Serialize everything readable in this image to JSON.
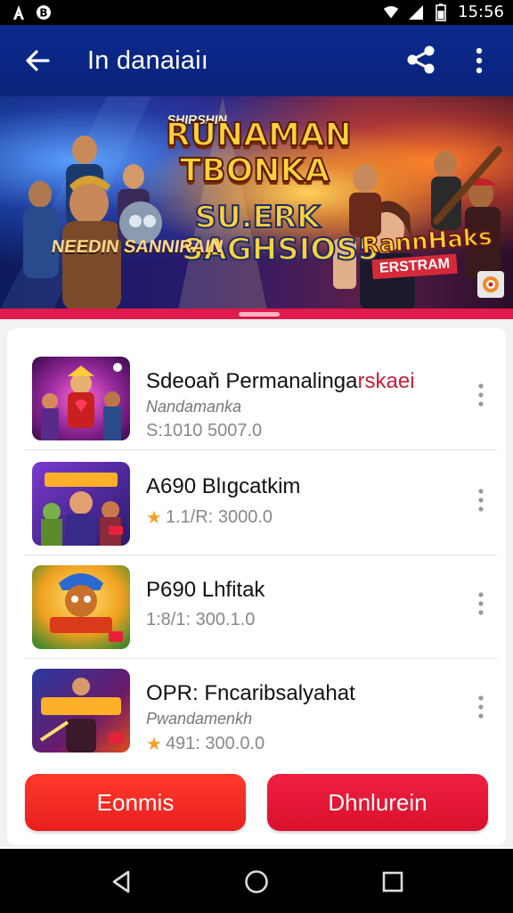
{
  "status_bar": {
    "time": "15:56",
    "icons": [
      "notification-a-icon",
      "notification-b-icon",
      "wifi-icon",
      "signal-icon",
      "battery-icon"
    ]
  },
  "app_bar": {
    "title": "In danaiaiı",
    "icons": [
      "back-arrow-icon",
      "share-icon",
      "more-vert-icon"
    ],
    "color": "#0b2a8f"
  },
  "banner": {
    "small_text": "SHIRSHIN",
    "title": "RUNAMAN TBONKA",
    "subtitle": "SU.ERK SAGHSIOS5",
    "left_caption": "NEEDIN SANNIRAIN",
    "right_title": "RannHaks",
    "right_tag": "ERSTRAM"
  },
  "list": [
    {
      "name": "Sdeoaň Permanalinga",
      "name_accent": "rskaei",
      "subtitle": "Nandamanka",
      "meta_prefix": "",
      "meta": "S:1010 5007.0",
      "rating_star": false
    },
    {
      "name": "A690 Blıgcatkim",
      "name_accent": "",
      "subtitle": "",
      "meta_prefix": "",
      "meta": "1.1/R: 3000.0",
      "rating_star": true
    },
    {
      "name": "P690 Lhfitak",
      "name_accent": "",
      "subtitle": "",
      "meta_prefix": "",
      "meta": "1:8/1: 300.1.0",
      "rating_star": false
    },
    {
      "name": "OPR: Fncaribsalyahat",
      "name_accent": "",
      "subtitle": "Pwandamenkh",
      "meta_prefix": "",
      "meta": "491: 300.0.0",
      "rating_star": true
    }
  ],
  "buttons": {
    "left": "Eonmis",
    "right": "Dhnlurein"
  },
  "nav_bar": {
    "icons": [
      "nav-back-icon",
      "nav-home-icon",
      "nav-recents-icon"
    ]
  }
}
